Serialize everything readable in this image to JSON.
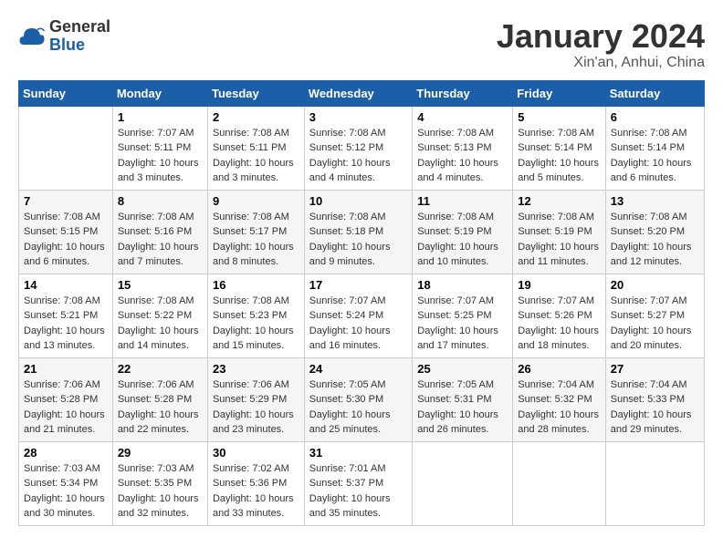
{
  "logo": {
    "text_general": "General",
    "text_blue": "Blue"
  },
  "header": {
    "title": "January 2024",
    "subtitle": "Xin'an, Anhui, China"
  },
  "days_of_week": [
    "Sunday",
    "Monday",
    "Tuesday",
    "Wednesday",
    "Thursday",
    "Friday",
    "Saturday"
  ],
  "weeks": [
    [
      {
        "day": "",
        "sunrise": "",
        "sunset": "",
        "daylight": ""
      },
      {
        "day": "1",
        "sunrise": "Sunrise: 7:07 AM",
        "sunset": "Sunset: 5:11 PM",
        "daylight": "Daylight: 10 hours and 3 minutes."
      },
      {
        "day": "2",
        "sunrise": "Sunrise: 7:08 AM",
        "sunset": "Sunset: 5:11 PM",
        "daylight": "Daylight: 10 hours and 3 minutes."
      },
      {
        "day": "3",
        "sunrise": "Sunrise: 7:08 AM",
        "sunset": "Sunset: 5:12 PM",
        "daylight": "Daylight: 10 hours and 4 minutes."
      },
      {
        "day": "4",
        "sunrise": "Sunrise: 7:08 AM",
        "sunset": "Sunset: 5:13 PM",
        "daylight": "Daylight: 10 hours and 4 minutes."
      },
      {
        "day": "5",
        "sunrise": "Sunrise: 7:08 AM",
        "sunset": "Sunset: 5:14 PM",
        "daylight": "Daylight: 10 hours and 5 minutes."
      },
      {
        "day": "6",
        "sunrise": "Sunrise: 7:08 AM",
        "sunset": "Sunset: 5:14 PM",
        "daylight": "Daylight: 10 hours and 6 minutes."
      }
    ],
    [
      {
        "day": "7",
        "sunrise": "Sunrise: 7:08 AM",
        "sunset": "Sunset: 5:15 PM",
        "daylight": "Daylight: 10 hours and 6 minutes."
      },
      {
        "day": "8",
        "sunrise": "Sunrise: 7:08 AM",
        "sunset": "Sunset: 5:16 PM",
        "daylight": "Daylight: 10 hours and 7 minutes."
      },
      {
        "day": "9",
        "sunrise": "Sunrise: 7:08 AM",
        "sunset": "Sunset: 5:17 PM",
        "daylight": "Daylight: 10 hours and 8 minutes."
      },
      {
        "day": "10",
        "sunrise": "Sunrise: 7:08 AM",
        "sunset": "Sunset: 5:18 PM",
        "daylight": "Daylight: 10 hours and 9 minutes."
      },
      {
        "day": "11",
        "sunrise": "Sunrise: 7:08 AM",
        "sunset": "Sunset: 5:19 PM",
        "daylight": "Daylight: 10 hours and 10 minutes."
      },
      {
        "day": "12",
        "sunrise": "Sunrise: 7:08 AM",
        "sunset": "Sunset: 5:19 PM",
        "daylight": "Daylight: 10 hours and 11 minutes."
      },
      {
        "day": "13",
        "sunrise": "Sunrise: 7:08 AM",
        "sunset": "Sunset: 5:20 PM",
        "daylight": "Daylight: 10 hours and 12 minutes."
      }
    ],
    [
      {
        "day": "14",
        "sunrise": "Sunrise: 7:08 AM",
        "sunset": "Sunset: 5:21 PM",
        "daylight": "Daylight: 10 hours and 13 minutes."
      },
      {
        "day": "15",
        "sunrise": "Sunrise: 7:08 AM",
        "sunset": "Sunset: 5:22 PM",
        "daylight": "Daylight: 10 hours and 14 minutes."
      },
      {
        "day": "16",
        "sunrise": "Sunrise: 7:08 AM",
        "sunset": "Sunset: 5:23 PM",
        "daylight": "Daylight: 10 hours and 15 minutes."
      },
      {
        "day": "17",
        "sunrise": "Sunrise: 7:07 AM",
        "sunset": "Sunset: 5:24 PM",
        "daylight": "Daylight: 10 hours and 16 minutes."
      },
      {
        "day": "18",
        "sunrise": "Sunrise: 7:07 AM",
        "sunset": "Sunset: 5:25 PM",
        "daylight": "Daylight: 10 hours and 17 minutes."
      },
      {
        "day": "19",
        "sunrise": "Sunrise: 7:07 AM",
        "sunset": "Sunset: 5:26 PM",
        "daylight": "Daylight: 10 hours and 18 minutes."
      },
      {
        "day": "20",
        "sunrise": "Sunrise: 7:07 AM",
        "sunset": "Sunset: 5:27 PM",
        "daylight": "Daylight: 10 hours and 20 minutes."
      }
    ],
    [
      {
        "day": "21",
        "sunrise": "Sunrise: 7:06 AM",
        "sunset": "Sunset: 5:28 PM",
        "daylight": "Daylight: 10 hours and 21 minutes."
      },
      {
        "day": "22",
        "sunrise": "Sunrise: 7:06 AM",
        "sunset": "Sunset: 5:28 PM",
        "daylight": "Daylight: 10 hours and 22 minutes."
      },
      {
        "day": "23",
        "sunrise": "Sunrise: 7:06 AM",
        "sunset": "Sunset: 5:29 PM",
        "daylight": "Daylight: 10 hours and 23 minutes."
      },
      {
        "day": "24",
        "sunrise": "Sunrise: 7:05 AM",
        "sunset": "Sunset: 5:30 PM",
        "daylight": "Daylight: 10 hours and 25 minutes."
      },
      {
        "day": "25",
        "sunrise": "Sunrise: 7:05 AM",
        "sunset": "Sunset: 5:31 PM",
        "daylight": "Daylight: 10 hours and 26 minutes."
      },
      {
        "day": "26",
        "sunrise": "Sunrise: 7:04 AM",
        "sunset": "Sunset: 5:32 PM",
        "daylight": "Daylight: 10 hours and 28 minutes."
      },
      {
        "day": "27",
        "sunrise": "Sunrise: 7:04 AM",
        "sunset": "Sunset: 5:33 PM",
        "daylight": "Daylight: 10 hours and 29 minutes."
      }
    ],
    [
      {
        "day": "28",
        "sunrise": "Sunrise: 7:03 AM",
        "sunset": "Sunset: 5:34 PM",
        "daylight": "Daylight: 10 hours and 30 minutes."
      },
      {
        "day": "29",
        "sunrise": "Sunrise: 7:03 AM",
        "sunset": "Sunset: 5:35 PM",
        "daylight": "Daylight: 10 hours and 32 minutes."
      },
      {
        "day": "30",
        "sunrise": "Sunrise: 7:02 AM",
        "sunset": "Sunset: 5:36 PM",
        "daylight": "Daylight: 10 hours and 33 minutes."
      },
      {
        "day": "31",
        "sunrise": "Sunrise: 7:01 AM",
        "sunset": "Sunset: 5:37 PM",
        "daylight": "Daylight: 10 hours and 35 minutes."
      },
      {
        "day": "",
        "sunrise": "",
        "sunset": "",
        "daylight": ""
      },
      {
        "day": "",
        "sunrise": "",
        "sunset": "",
        "daylight": ""
      },
      {
        "day": "",
        "sunrise": "",
        "sunset": "",
        "daylight": ""
      }
    ]
  ]
}
